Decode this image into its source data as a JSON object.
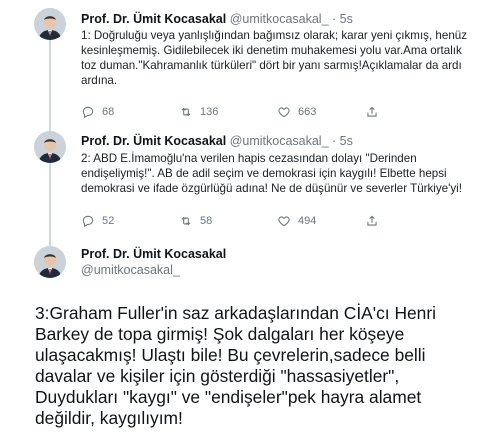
{
  "tweets": [
    {
      "author_name": "Prof. Dr. Ümit Kocasakal",
      "handle": "@umitkocasakal_",
      "separator": "·",
      "time": "5s",
      "lines": [
        "1: Doğruluğu veya yanlışlığından bağımsız olarak; karar yeni çıkmış, henüz",
        "kesinleşmemiş. Gidilebilecek iki denetim muhakemesi yolu var.Ama ortalık",
        "toz duman.\"Kahramanlık türküleri\" dört bir yanı sarmış!Açıklamalar da ardı",
        "ardına."
      ],
      "replies": "68",
      "retweets": "136",
      "likes": "663"
    },
    {
      "author_name": "Prof. Dr. Ümit Kocasakal",
      "handle": "@umitkocasakal_",
      "separator": "·",
      "time": "5s",
      "lines": [
        "2: ABD E.İmamoğlu'na verilen hapis cezasından dolayı \"Derinden",
        "endişeliymiş!\". AB de adil seçim ve demokrasi için kaygılı! Elbette hepsi",
        "demokrasi ve ifade özgürlüğü adına! Ne de düşünür ve severler Türkiye'yi!"
      ],
      "replies": "52",
      "retweets": "58",
      "likes": "494"
    },
    {
      "author_name": "Prof. Dr. Ümit Kocasakal",
      "handle": "@umitkocasakal_",
      "lines": [
        "3:Graham Fuller'in saz arkadaşlarından CİA'cı Henri",
        "Barkey de topa girmiş! Şok dalgaları her köşeye",
        "ulaşacakmış! Ulaştı bile! Bu çevrelerin,sadece belli",
        "davalar ve kişiler için gösterdiği \"hassasiyetler\",",
        "Duydukları \"kaygı\" ve \"endişeler\"pek hayra alamet",
        "değildir, kaygılıyım!"
      ]
    }
  ],
  "icons": {
    "reply": "reply-icon",
    "retweet": "retweet-icon",
    "like": "heart-icon",
    "share": "share-icon"
  },
  "colors": {
    "text": "#0f1419",
    "muted": "#6b7680",
    "thread_line": "#cfd9de"
  }
}
